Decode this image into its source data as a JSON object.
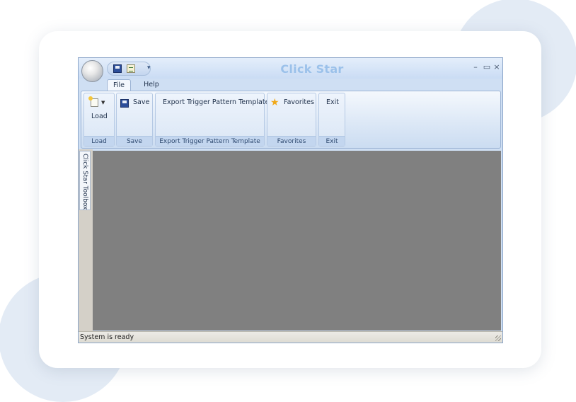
{
  "window": {
    "title": "Click Star",
    "controls": {
      "minimize": "–",
      "maximize": "▭",
      "close": "×"
    }
  },
  "quick_access": {
    "more": "▾"
  },
  "tabs": [
    {
      "label": "File",
      "active": true
    },
    {
      "label": "Help",
      "active": false
    }
  ],
  "ribbon": {
    "groups": [
      {
        "button": "Load",
        "caption": "Load",
        "icon": "new-document-icon"
      },
      {
        "button": "Save",
        "caption": "Save",
        "icon": "floppy-disk-icon"
      },
      {
        "button": "Export Trigger Pattern Template",
        "caption": "Export Trigger Pattern Template"
      },
      {
        "button": "Favorites",
        "caption": "Favorites",
        "icon": "star-icon"
      },
      {
        "button": "Exit",
        "caption": "Exit"
      }
    ]
  },
  "side_panel": {
    "tab_label": "Click Star Toolbox"
  },
  "status": {
    "text": "System is ready"
  },
  "colors": {
    "title_accent": "#9bc1ea",
    "workspace": "#808080",
    "ribbon_bg": "#dbe7f6"
  }
}
